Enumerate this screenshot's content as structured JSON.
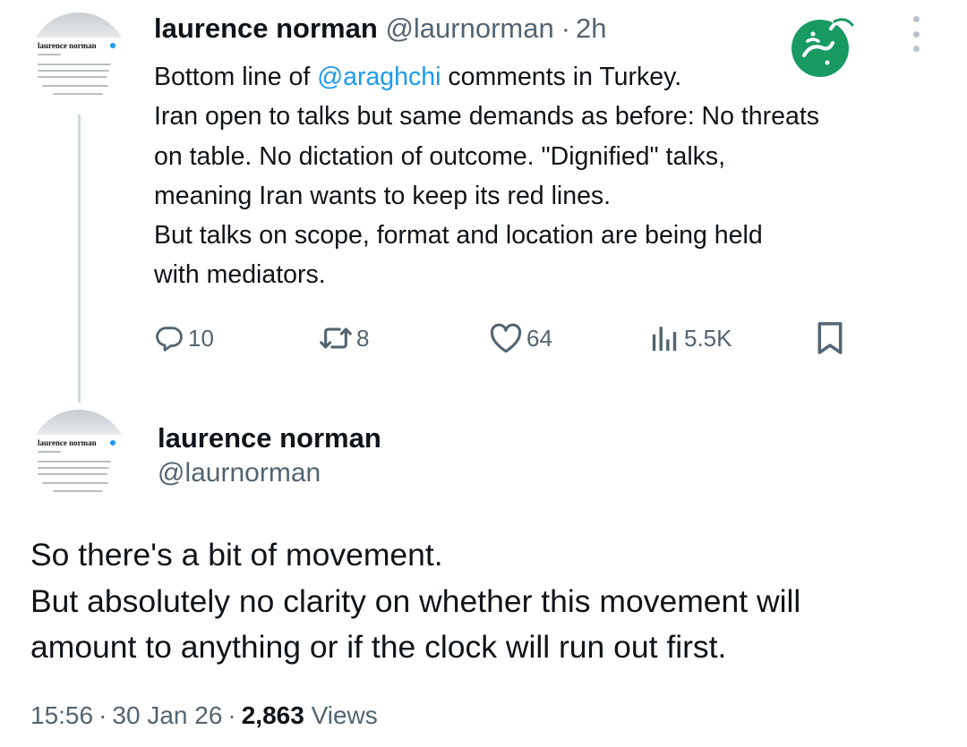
{
  "tweet1": {
    "avatar_name": "laurence norman",
    "name": "laurence norman",
    "handle": "@laurnorman",
    "separator": "·",
    "time": "2h",
    "body": {
      "line1_prefix": "Bottom line of ",
      "line1_mention": "@araghchi",
      "line1_suffix": " comments in Turkey.",
      "line2": "Iran open to talks but same demands as before: No threats",
      "line3": "on table. No dictation of outcome. \"Dignified\" talks,",
      "line4": "meaning Iran wants to keep its red lines.",
      "line5": "But talks on scope, format and location are being held",
      "line6": "with mediators."
    },
    "actions": {
      "replies": "10",
      "reposts": "8",
      "likes": "64",
      "views": "5.5K"
    },
    "icons": {
      "reply": "reply-icon",
      "repost": "repost-icon",
      "like": "heart-icon",
      "views": "analytics-icon",
      "bookmark": "bookmark-icon",
      "more": "more-vertical-icon"
    }
  },
  "tweet2": {
    "avatar_name": "laurence norman",
    "name": "laurence norman",
    "handle": "@laurnorman",
    "body": {
      "line1": "So there's a bit of movement.",
      "line2": "But absolutely no clarity on whether this movement will",
      "line3": "amount to anything or if the clock will run out first."
    },
    "meta": {
      "time": "15:56",
      "sep1": "·",
      "date": "30 Jan 26",
      "sep2": "·",
      "views_count": "2,863",
      "views_label": " Views"
    }
  },
  "colors": {
    "text": "#0f1419",
    "secondary": "#536471",
    "link": "#1d9bf0",
    "watermark": "#1a9a63",
    "thread_line": "#cfd9de"
  }
}
